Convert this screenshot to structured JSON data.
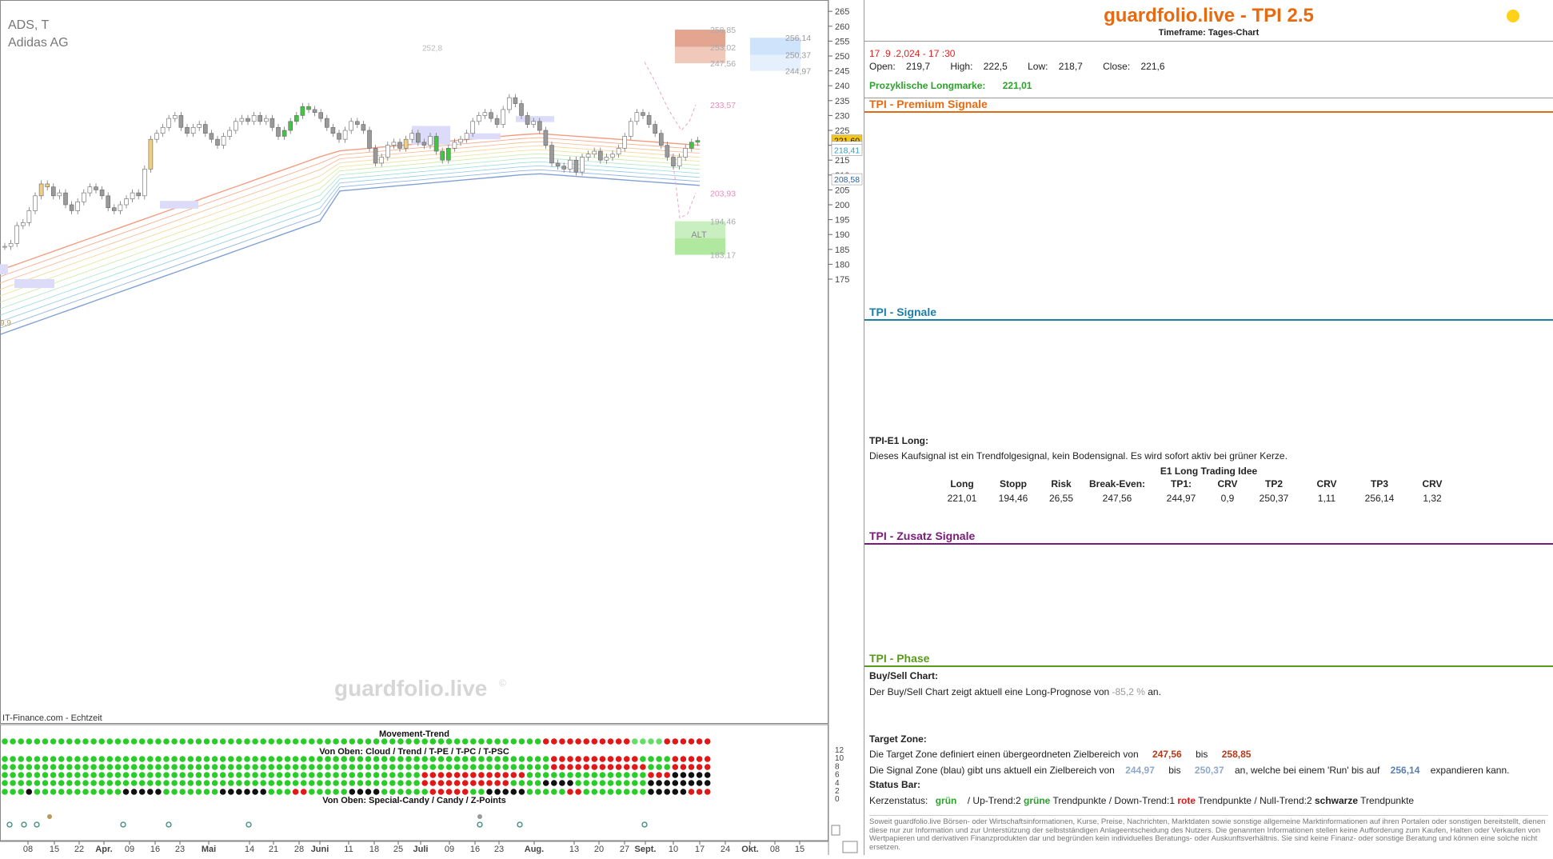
{
  "chart": {
    "symbol": "ADS, T",
    "name": "Adidas AG",
    "watermark": "guardfolio.live",
    "watermark_mark": "©",
    "source": "IT-Finance.com - Echtzeit",
    "left_edge_label": "9,9",
    "y_ticks": [
      "265",
      "260",
      "255",
      "250",
      "245",
      "240",
      "235",
      "230",
      "225",
      "220",
      "215",
      "210",
      "205",
      "200",
      "195",
      "190",
      "185",
      "180",
      "175"
    ],
    "x_ticks": [
      "08",
      "15",
      "22",
      "Apr.",
      "09",
      "16",
      "23",
      "Mai",
      "14",
      "21",
      "28",
      "Juni",
      "11",
      "18",
      "25",
      "Juli",
      "09",
      "16",
      "23",
      "Aug.",
      "13",
      "20",
      "27",
      "Sept.",
      "10",
      "17",
      "24",
      "Okt.",
      "08",
      "15"
    ],
    "price_tags": {
      "close": "221,60",
      "long": "221,01",
      "cyan": "218,41",
      "blue": "208,58"
    },
    "zone_labels": {
      "target_top": "258,85",
      "target_mid": "253,02",
      "target_bottom": "247,56",
      "signal_top": "256,14",
      "signal_mid": "250,37",
      "signal_bottom": "244,97",
      "pink_upper": "233,57",
      "pink_lower": "203,93",
      "alt_top": "194,46",
      "alt_bottom": "183,17",
      "alt_label": "ALT",
      "peak_label": "252,8"
    },
    "movement_title": "Movement-Trend",
    "row_title_top": "Von Oben: Cloud / Trend / T-PE / T-PC / T-PSC",
    "row_title_bottom": "Von Oben: Special-Candy / Candy / Z-Points",
    "sub_ticks": [
      "12",
      "10",
      "8",
      "6",
      "4",
      "2",
      "0"
    ],
    "colors": {
      "green": "#29cc29",
      "red": "#e01818",
      "black": "#111111",
      "orange": "#e86a10"
    }
  },
  "panel": {
    "title": "guardfolio.live - TPI 2.5",
    "timeframe": "Timeframe: Tages-Chart",
    "date": "17 .9 .2,024  - 17 :30",
    "open_label": "Open:",
    "open": "219,7",
    "high_label": "High:",
    "high": "222,5",
    "low_label": "Low:",
    "low": "218,7",
    "close_label": "Close:",
    "close": "221,6",
    "longmark_label": "Prozyklische Longmarke:",
    "longmark": "221,01",
    "premium": "TPI - Premium Signale",
    "signale": "TPI - Signale",
    "e1_title": "TPI-E1 Long:",
    "e1_text": "Dieses Kaufsignal ist ein Trendfolgesignal, kein Bodensignal. Es wird sofort aktiv bei grüner Kerze.",
    "e1_idea": "E1 Long Trading Idee",
    "trade_headers": [
      "Long",
      "Stopp",
      "Risk",
      "Break-Even:",
      "TP1:",
      "CRV",
      "TP2",
      "CRV",
      "TP3",
      "CRV"
    ],
    "trade_values": [
      "221,01",
      "194,46",
      "26,55",
      "247,56",
      "244,97",
      "0,9",
      "250,37",
      "1,11",
      "256,14",
      "1,32"
    ],
    "zusatz": "TPI - Zusatz Signale",
    "phase": "TPI - Phase",
    "bs_title": "Buy/Sell Chart:",
    "bs_text_pre": "Der Buy/Sell Chart zeigt aktuell eine Long-Prognose von",
    "bs_value": "-85,2 %",
    "bs_text_post": "an.",
    "tz_title": "Target Zone:",
    "tz_text": "Die Target Zone definiert einen übergeordneten Zielbereich von",
    "tz_from": "247,56",
    "tz_bis": "bis",
    "tz_to": "258,85",
    "sz_text": "Die Signal Zone (blau) gibt uns aktuell ein Zielbereich von",
    "sz_from": "244,97",
    "sz_bis": "bis",
    "sz_to": "250,37",
    "sz_text2": "an, welche bei einem 'Run' bis auf",
    "sz_run": "256,14",
    "sz_text3": "expandieren kann.",
    "status_title": "Status Bar:",
    "status_label": "Kerzenstatus:",
    "status_green": "grün",
    "status_up": "/ Up-Trend:2",
    "status_up_word": "grüne",
    "status_tp1": "Trendpunkte  / Down-Trend:1",
    "status_down_word": "rote",
    "status_tp2": "Trendpunkte / Null-Trend:2",
    "status_null_word": "schwarze",
    "status_tp3": "Trendpunkte",
    "disclaimer": "Soweit guardfolio.live Börsen- oder Wirtschaftsinformationen, Kurse, Preise, Nachrichten, Marktdaten sowie sonstige allgemeine Marktinformationen auf ihren Portalen oder sonstigen bereitstellt, dienen diese nur zur Information und zur Unterstützung der selbstständigen Anlageentscheidung des Nutzers. Die genannten Informationen stellen keine Aufforderung zum Kaufen, Halten oder Verkaufen von Wertpapieren und derivativen Finanzprodukten dar und begründen kein individuelles Beratungs- oder Auskunftsverhältnis. Sie sind keine Finanz- oder sonstige Beratung und können eine solche nicht ersetzen."
  }
}
